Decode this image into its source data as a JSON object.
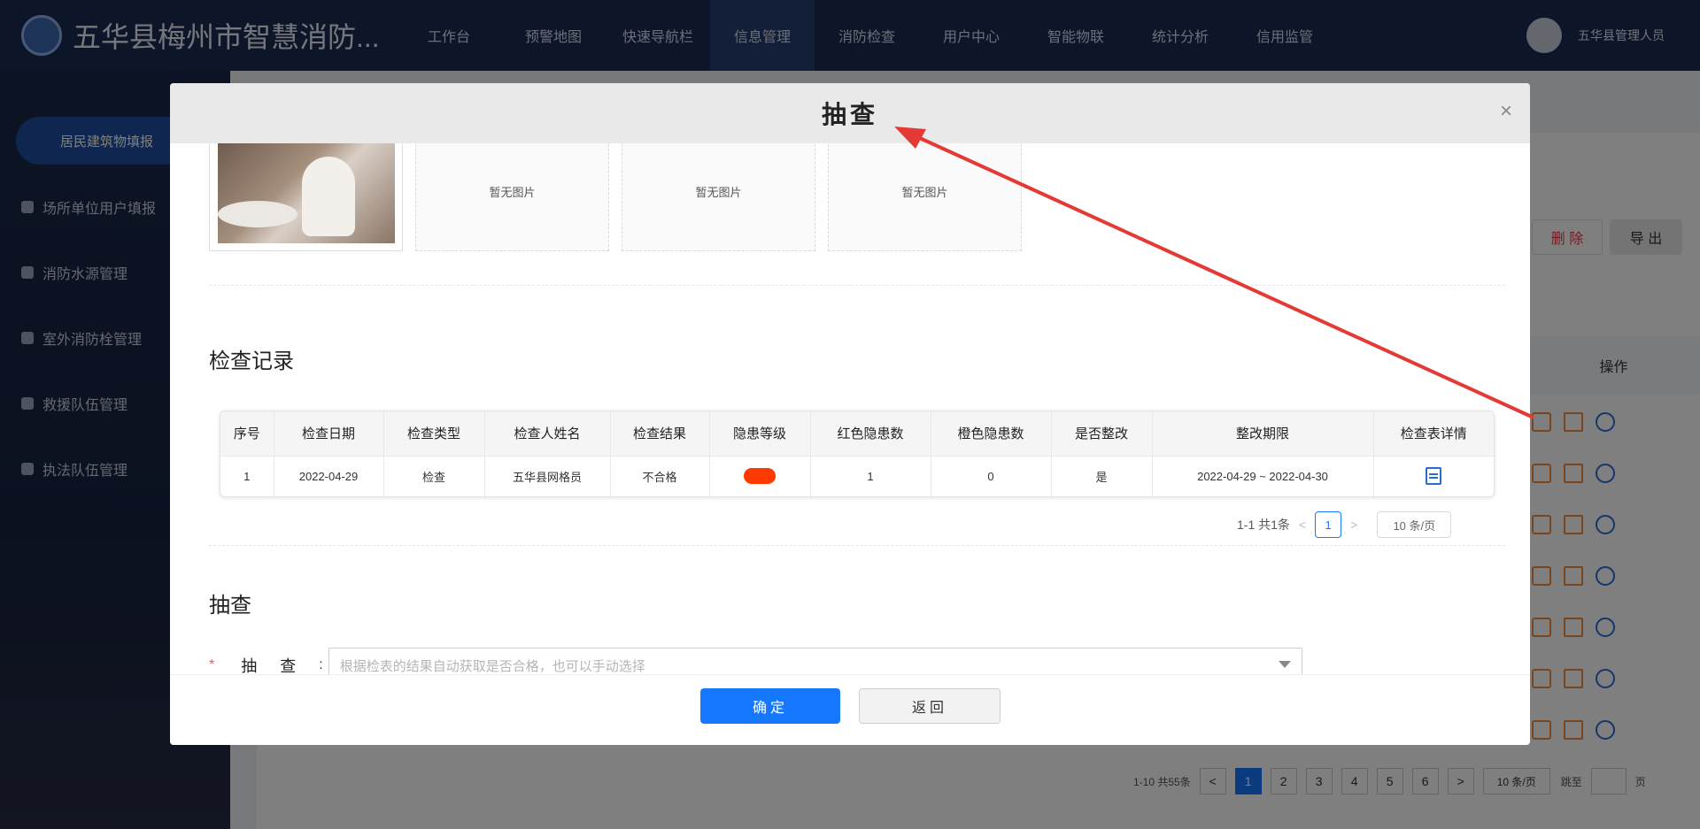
{
  "app": {
    "title": "五华县梅州市智慧消防...",
    "logo_text": "智慧消防",
    "user_name": "五华县管理人员"
  },
  "nav": [
    "工作台",
    "预警地图",
    "快速导航栏",
    "信息管理",
    "消防检查",
    "用户中心",
    "智能物联",
    "统计分析",
    "信用监管"
  ],
  "sidebar": {
    "active": "居民建筑物填报",
    "items": [
      "场所单位用户填报",
      "消防水源管理",
      "室外消防栓管理",
      "救援队伍管理",
      "执法队伍管理"
    ]
  },
  "background_page": {
    "delete_label": "删 除",
    "export_label": "导 出",
    "actions_header": "操作",
    "pager_total": "1-10 共55条",
    "pages": [
      "1",
      "2",
      "3",
      "4",
      "5",
      "6"
    ],
    "page_size": "10 条/页",
    "goto_label": "跳至",
    "page_suffix": "页"
  },
  "modal": {
    "title": "抽查",
    "close_glyph": "×",
    "no_image_text": "暂无图片",
    "records_title": "检查记录",
    "table": {
      "headers": [
        "序号",
        "检查日期",
        "检查类型",
        "检查人姓名",
        "检查结果",
        "隐患等级",
        "红色隐患数",
        "橙色隐患数",
        "是否整改",
        "整改期限",
        "检查表详情"
      ],
      "rows": [
        {
          "index": "1",
          "date": "2022-04-29",
          "type": "检查",
          "inspector": "五华县网格员",
          "result": "不合格",
          "level_color": "#ff3a00",
          "red_count": "1",
          "orange_count": "0",
          "rectified": "是",
          "deadline": "2022-04-29 ~ 2022-04-30"
        }
      ]
    },
    "pager": {
      "total": "1-1 共1条",
      "prev": "<",
      "current": "1",
      "next": ">",
      "page_size": "10 条/页"
    },
    "spot_check_title": "抽查",
    "form": {
      "required_mark": "*",
      "label": "抽查",
      "colon": ":",
      "placeholder": "根据检表的结果自动获取是否合格，也可以手动选择"
    },
    "ok_label": "确定",
    "back_label": "返回"
  },
  "colors": {
    "primary": "#1677ff",
    "annotation_arrow": "#e53935",
    "danger": "#ff3a00"
  }
}
